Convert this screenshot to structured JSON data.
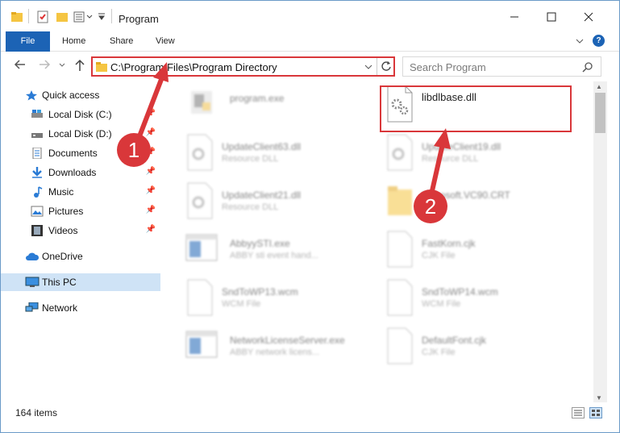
{
  "window": {
    "title": "Program"
  },
  "ribbon": {
    "tabs": [
      "File",
      "Home",
      "Share",
      "View"
    ]
  },
  "address": {
    "path": "C:\\Program Files\\Program Directory"
  },
  "search": {
    "placeholder": "Search Program"
  },
  "sidebar": {
    "items": [
      {
        "label": "Quick access",
        "icon": "star-icon"
      },
      {
        "label": "Local Disk (C:)",
        "icon": "drive-icon",
        "pinned": true
      },
      {
        "label": "Local Disk (D:)",
        "icon": "drive-icon",
        "pinned": true
      },
      {
        "label": "Documents",
        "icon": "documents-icon",
        "pinned": true
      },
      {
        "label": "Downloads",
        "icon": "downloads-icon",
        "pinned": true
      },
      {
        "label": "Music",
        "icon": "music-icon",
        "pinned": true
      },
      {
        "label": "Pictures",
        "icon": "pictures-icon",
        "pinned": true
      },
      {
        "label": "Videos",
        "icon": "videos-icon",
        "pinned": true
      },
      {
        "label": "OneDrive",
        "icon": "cloud-icon"
      },
      {
        "label": "This PC",
        "icon": "computer-icon",
        "selected": true
      },
      {
        "label": "Network",
        "icon": "network-icon"
      }
    ]
  },
  "files": [
    {
      "name": "program.exe",
      "type": "",
      "icon": "exe-icon"
    },
    {
      "name": "libdlbase.dll",
      "type": "",
      "icon": "dll-gear-icon",
      "highlighted": true
    },
    {
      "name": "UpdateClient63.dll",
      "type": "Resource DLL",
      "icon": "dll-gear-icon"
    },
    {
      "name": "UpdateClient19.dll",
      "type": "Resource DLL",
      "icon": "dll-gear-icon"
    },
    {
      "name": "UpdateClient21.dll",
      "type": "Resource DLL",
      "icon": "dll-gear-icon"
    },
    {
      "name": "Microsoft.VC90.CRT",
      "type": "",
      "icon": "folder-icon"
    },
    {
      "name": "AbbyySTI.exe",
      "type": "ABBY sti event hand...",
      "icon": "app-window-icon"
    },
    {
      "name": "FastKorn.cjk",
      "type": "CJK File",
      "icon": "blank-file-icon"
    },
    {
      "name": "SndToWP13.wcm",
      "type": "WCM File",
      "icon": "blank-file-icon"
    },
    {
      "name": "SndToWP14.wcm",
      "type": "WCM File",
      "icon": "blank-file-icon"
    },
    {
      "name": "NetworkLicenseServer.exe",
      "type": "ABBY network licens...",
      "icon": "app-window-icon"
    },
    {
      "name": "DefaultFont.cjk",
      "type": "CJK File",
      "icon": "blank-file-icon"
    }
  ],
  "status": {
    "item_count": "164 items"
  },
  "annotations": {
    "badge1": "1",
    "badge2": "2",
    "color": "#d9373a"
  },
  "colors": {
    "accent": "#1c63b5",
    "selection": "#cfe3f6",
    "highlight": "#d9373a"
  }
}
